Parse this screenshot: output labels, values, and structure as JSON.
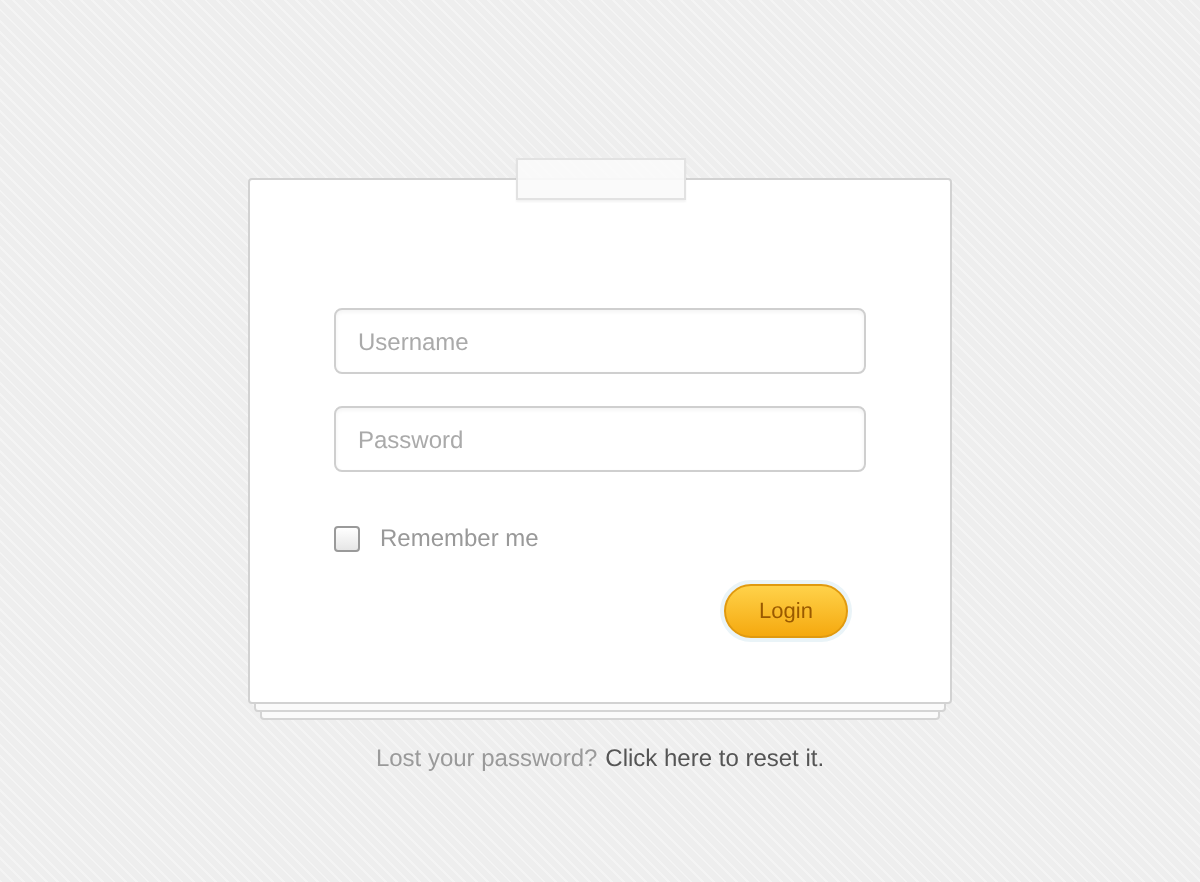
{
  "form": {
    "username": {
      "placeholder": "Username"
    },
    "password": {
      "placeholder": "Password"
    },
    "remember": {
      "label": "Remember me",
      "checked": false
    },
    "submit": "Login"
  },
  "footer": {
    "prompt": "Lost your password?",
    "link": "Click here to reset it."
  }
}
